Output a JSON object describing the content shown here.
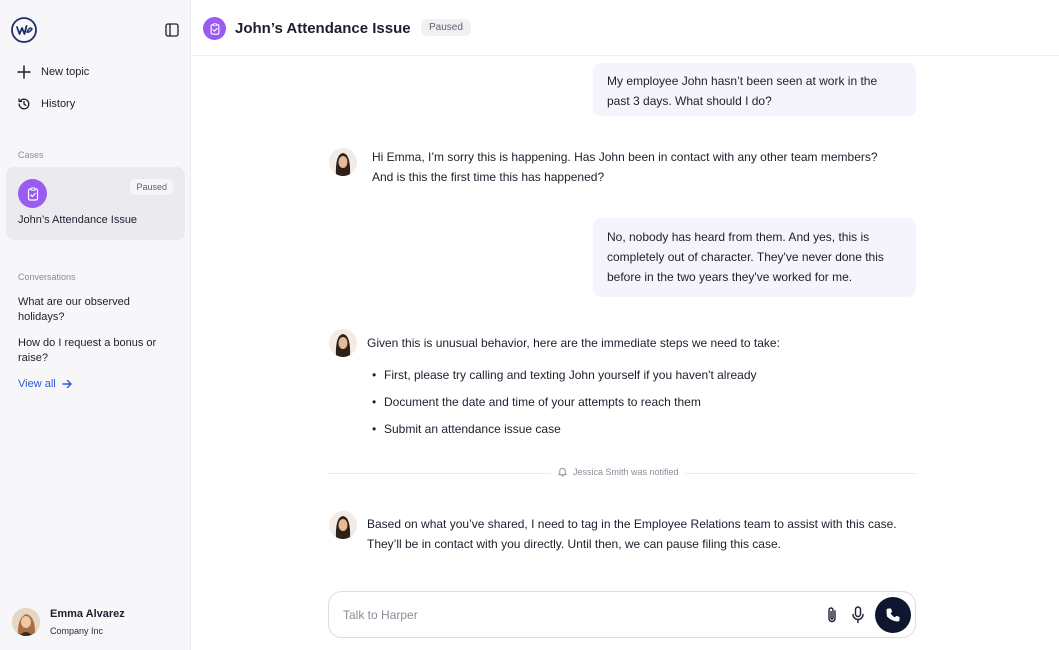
{
  "sidebar": {
    "new_topic": "New topic",
    "history": "History",
    "cases_label": "Cases",
    "case": {
      "badge": "Paused",
      "title": "John’s Attendance Issue"
    },
    "conversations_label": "Conversations",
    "conversations": [
      "What are our observed holidays?",
      "How do I request a bonus or raise?"
    ],
    "view_all": "View all",
    "user": {
      "name": "Emma Alvarez",
      "company": "Company Inc"
    }
  },
  "header": {
    "title": "John’s Attendance Issue",
    "badge": "Paused"
  },
  "chat": {
    "user_msg_1": [
      "My employee John hasn’t been seen at work in the",
      "past 3 days. What should I do?"
    ],
    "bot_msg_1": [
      "Hi Emma, I’m sorry this is happening. Has John  been in contact with any other team members?",
      "And is this the first time this has happened?"
    ],
    "user_msg_2": [
      "No, nobody has heard from them. And yes, this is",
      "completely out of character. They've never done this",
      "before in the two years they've worked for me."
    ],
    "bot_msg_2_intro": "Given this is unusual behavior, here are the immediate steps we need to take:",
    "bot_msg_2_steps": [
      "First, please try calling and texting John yourself if you haven't already",
      "Document the date and time of your attempts to reach them",
      "Submit an attendance issue case"
    ],
    "notification": "Jessica Smith was notified",
    "bot_msg_3": [
      "Based on what you’ve shared, I need to tag in the Employee Relations team to assist with this case.",
      "They’ll be in contact with you directly. Until then, we can pause filing this case."
    ]
  },
  "composer": {
    "placeholder": "Talk to Harper",
    "value": ""
  },
  "colors": {
    "accent_purple": "#9a5cf0",
    "call_button": "#0f1630",
    "link_blue": "#2a59d6",
    "user_bubble": "#f5f3fb"
  },
  "icons": [
    "logo-icon",
    "sidebar-toggle-icon",
    "plus-icon",
    "history-icon",
    "clipboard-check-icon",
    "arrow-right-icon",
    "bell-icon",
    "paperclip-icon",
    "microphone-icon",
    "phone-icon"
  ]
}
